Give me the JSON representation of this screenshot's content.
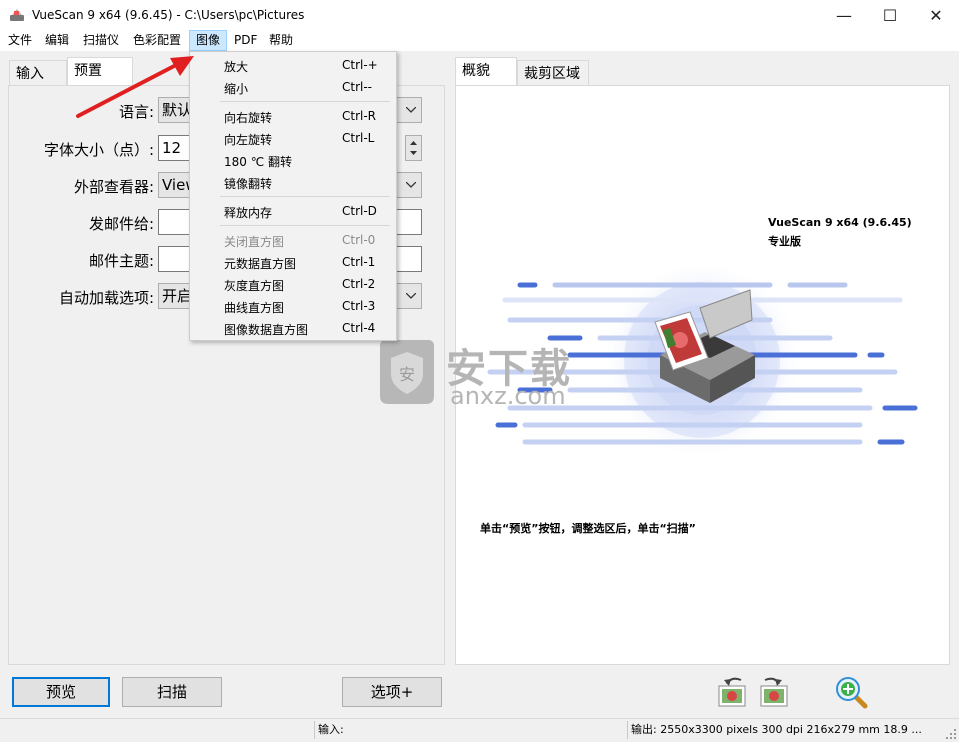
{
  "window": {
    "title": "VueScan 9 x64 (9.6.45) - C:\\Users\\pc\\Pictures",
    "minimize": "—",
    "maximize": "☐",
    "close": "✕"
  },
  "menubar": {
    "items": [
      {
        "label": "文件"
      },
      {
        "label": "编辑"
      },
      {
        "label": "扫描仪"
      },
      {
        "label": "色彩配置"
      },
      {
        "label": "图像"
      },
      {
        "label": "PDF"
      },
      {
        "label": "帮助"
      }
    ]
  },
  "left_tabs": [
    {
      "label": "输入"
    },
    {
      "label": "预置"
    }
  ],
  "settings": {
    "language_label": "语言:",
    "language_value": "默认",
    "font_size_label": "字体大小（点）:",
    "font_size_value": "12",
    "viewer_label": "外部查看器:",
    "viewer_value": "View",
    "email_to_label": "发邮件给:",
    "email_to_value": "",
    "email_subject_label": "邮件主题:",
    "email_subject_value": "",
    "autoload_label": "自动加载选项:",
    "autoload_value": "开启"
  },
  "image_menu": {
    "items": [
      {
        "label": "放大",
        "shortcut": "Ctrl-+"
      },
      {
        "label": "缩小",
        "shortcut": "Ctrl--"
      },
      {
        "label": "向右旋转",
        "shortcut": "Ctrl-R"
      },
      {
        "label": "向左旋转",
        "shortcut": "Ctrl-L"
      },
      {
        "label": "180 ℃ 翻转",
        "shortcut": ""
      },
      {
        "label": "镜像翻转",
        "shortcut": ""
      },
      {
        "label": "释放内存",
        "shortcut": "Ctrl-D"
      },
      {
        "label": "关闭直方图",
        "shortcut": "Ctrl-0"
      },
      {
        "label": "元数据直方图",
        "shortcut": "Ctrl-1"
      },
      {
        "label": "灰度直方图",
        "shortcut": "Ctrl-2"
      },
      {
        "label": "曲线直方图",
        "shortcut": "Ctrl-3"
      },
      {
        "label": "图像数据直方图",
        "shortcut": "Ctrl-4"
      }
    ]
  },
  "right_tabs": [
    {
      "label": "概貌"
    },
    {
      "label": "裁剪区域"
    }
  ],
  "preview": {
    "product_name": "VueScan 9 x64 (9.6.45)",
    "edition": "专业版",
    "watermark_cn": "安下载",
    "watermark_en": "anxz.com",
    "hint": "单击“预览”按钮，调整选区后，单击“扫描”"
  },
  "buttons": {
    "preview": "预览",
    "scan": "扫描",
    "options": "选项+"
  },
  "statusbar": {
    "input": "输入:",
    "output": "输出: 2550x3300 pixels 300 dpi 216x279 mm 18.9 ..."
  },
  "colors": {
    "accent": "#0078d7",
    "menu_highlight": "#cce8ff",
    "arrow": "#e02020",
    "scan_lines": "#4a6fd6"
  }
}
